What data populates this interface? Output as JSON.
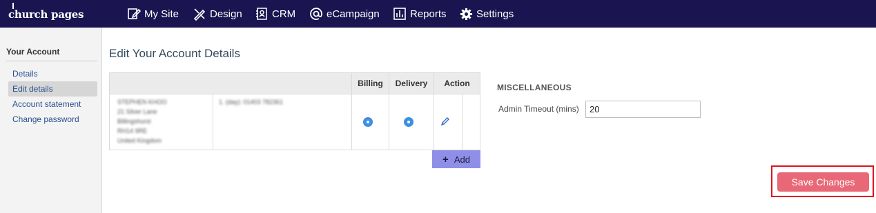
{
  "brand": {
    "logo_text": "church pages"
  },
  "nav": {
    "items": [
      {
        "label": "My Site",
        "icon": "edit-page-icon"
      },
      {
        "label": "Design",
        "icon": "design-tools-icon"
      },
      {
        "label": "CRM",
        "icon": "contacts-icon"
      },
      {
        "label": "eCampaign",
        "icon": "at-sign-icon"
      },
      {
        "label": "Reports",
        "icon": "bar-chart-icon"
      },
      {
        "label": "Settings",
        "icon": "gear-icon"
      }
    ]
  },
  "sidebar": {
    "title": "Your Account",
    "items": [
      {
        "label": "Details",
        "active": false
      },
      {
        "label": "Edit details",
        "active": true
      },
      {
        "label": "Account statement",
        "active": false
      },
      {
        "label": "Change password",
        "active": false
      }
    ]
  },
  "main": {
    "title": "Edit Your Account Details",
    "table": {
      "headers": {
        "billing": "Billing",
        "delivery": "Delivery",
        "action": "Action"
      },
      "row": {
        "address": "STEPHEN KHOO\n21 Silver Lane\nBillingshurst\nRH14 9RE\nUnited Kingdom",
        "phone": "1. (day): 01403 782361",
        "billing_selected": true,
        "delivery_selected": true,
        "action_icon": "pencil-icon"
      },
      "add_label": "Add"
    },
    "misc": {
      "title": "MISCELLANEOUS",
      "timeout_label": "Admin Timeout (mins)",
      "timeout_value": "20"
    },
    "save_label": "Save Changes"
  },
  "colors": {
    "nav_bg": "#1a1450",
    "radio": "#3d8fe3",
    "add_button": "#8f8fe8",
    "save_button": "#e86878",
    "highlight": "#e0121a"
  }
}
